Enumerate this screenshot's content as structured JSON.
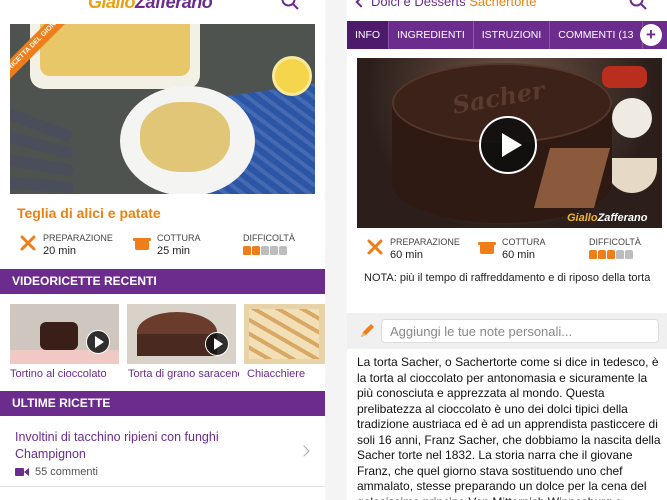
{
  "left": {
    "logo": {
      "part1": "Giallo",
      "part2": "Zafferano"
    },
    "hero": {
      "ribbon": "RICETTA DEL GIORNO"
    },
    "recipe_title": "Teglia di alici e patate",
    "prep": {
      "label": "PREPARAZIONE",
      "value": "20 min"
    },
    "cook": {
      "label": "COTTURA",
      "value": "25 min"
    },
    "difficulty": {
      "label": "DIFFICOLTÀ",
      "level": 2,
      "max": 5
    },
    "videos_section": "VIDEORICETTE RECENTI",
    "videos": [
      {
        "title": "Tortino al cioccolato"
      },
      {
        "title": "Torta di grano saraceno"
      },
      {
        "title": "Chiacchiere"
      }
    ],
    "latest_section": "ULTIME RICETTE",
    "latest": {
      "title": "Involtini di tacchino ripieni con funghi Champignon",
      "comments": "55 commenti"
    }
  },
  "right": {
    "nav": {
      "category": "Dolci e Desserts",
      "recipe": "Sachertorte"
    },
    "tabs": [
      "INFO",
      "INGREDIENTI",
      "ISTRUZIONI",
      "COMMENTI (13"
    ],
    "active_tab": "INFO",
    "add_label": "+",
    "image": {
      "cake_text": "Sacher",
      "watermark1": "Giallo",
      "watermark2": "Zafferano"
    },
    "prep": {
      "label": "PREPARAZIONE",
      "value": "60 min"
    },
    "cook": {
      "label": "COTTURA",
      "value": "60 min"
    },
    "difficulty": {
      "label": "DIFFICOLTÀ",
      "level": 3,
      "max": 5
    },
    "note": "NOTA: più il tempo di raffreddamento e di riposo della torta",
    "notes_placeholder": "Aggiungi le tue note personali...",
    "description": "La torta Sacher, o Sachertorte come si dice in tedesco, è la torta al cioccolato per antonomasia e sicuramente la più conosciuta e apprezzata al mondo. Questa prelibatezza al cioccolato è uno dei dolci tipici della tradizione austriaca ed è ad un apprendista pasticcere di soli 16 anni, Franz Sacher, che dobbiamo la nascita della Sacher torte nel 1832. La storia narra che il giovane Franz, che quel giorno stava sostituendo uno chef ammalato, stesse preparando un dolce per la cena del golosissimo principe Von Mitternich Winnesburg e,"
  },
  "colors": {
    "purple": "#6b2c8e",
    "orange": "#e9820f",
    "hat_on": "#ef7d1a",
    "hat_off": "#bdbdbd"
  }
}
